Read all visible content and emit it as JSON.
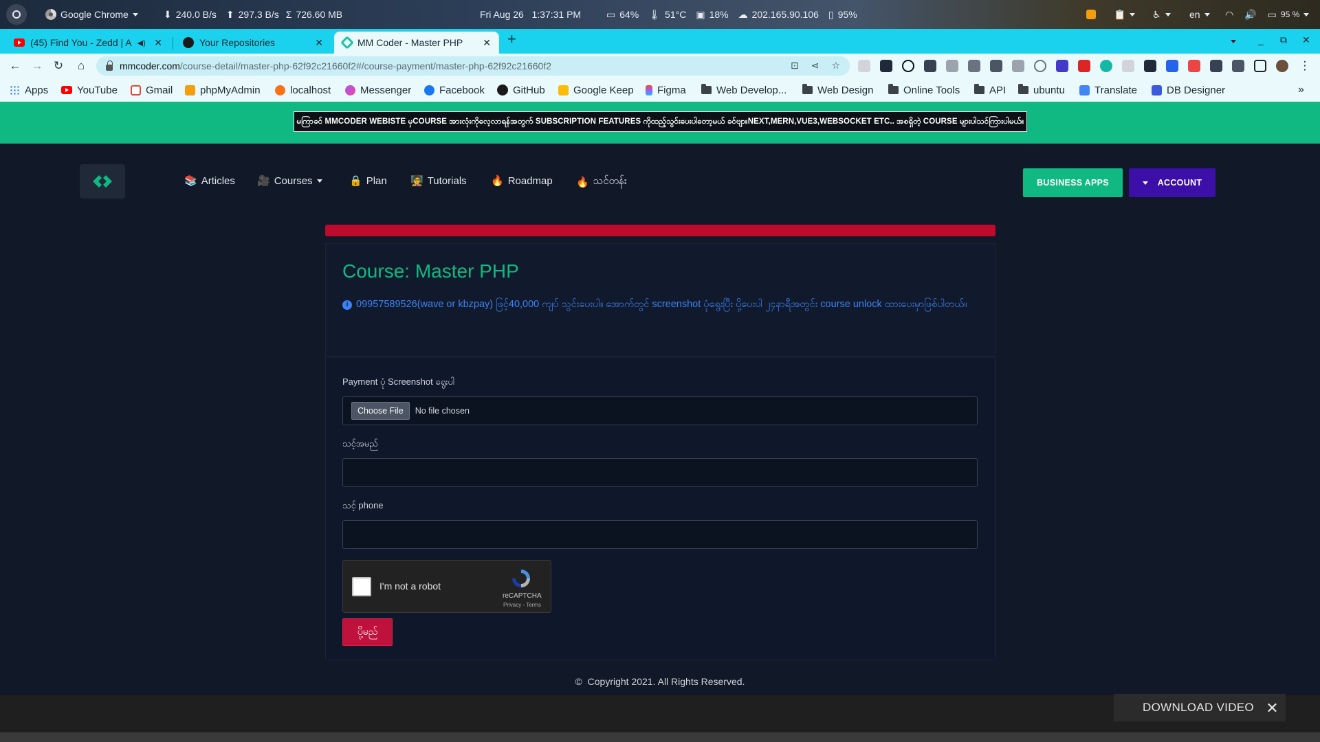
{
  "os_panel": {
    "app_name": "Google Chrome",
    "download_speed": "240.0 B/s",
    "upload_speed": "297.3 B/s",
    "total_transfer": "726.60 MB",
    "datetime": "Fri Aug 26   1:37:31 PM",
    "cpu": "64%",
    "temperature": "51°C",
    "memory": "18%",
    "ip": "202.165.90.106",
    "disk": "95%",
    "language": "en",
    "battery": "95 %"
  },
  "tabs": [
    {
      "title": "(45) Find You - Zedd | A",
      "favicon": "youtube-icon",
      "muted_icon": "speaker-icon"
    },
    {
      "title": "Your Repositories",
      "favicon": "github-icon"
    },
    {
      "title": "MM Coder - Master PHP",
      "favicon": "mmcoder-icon",
      "active": true
    }
  ],
  "address_bar": {
    "host": "mmcoder.com",
    "path": "/course-detail/master-php-62f92c21660f2#/course-payment/master-php-62f92c21660f2"
  },
  "bookmarks": [
    {
      "label": "Apps",
      "icon": "apps-grid-icon"
    },
    {
      "label": "YouTube",
      "icon": "youtube-icon"
    },
    {
      "label": "Gmail",
      "icon": "gmail-icon"
    },
    {
      "label": "phpMyAdmin",
      "icon": "phpmyadmin-icon"
    },
    {
      "label": "localhost",
      "icon": "localhost-icon"
    },
    {
      "label": "Messenger",
      "icon": "messenger-icon"
    },
    {
      "label": "Facebook",
      "icon": "facebook-icon"
    },
    {
      "label": "GitHub",
      "icon": "github-icon"
    },
    {
      "label": "Google Keep",
      "icon": "keep-icon"
    },
    {
      "label": "Figma",
      "icon": "figma-icon"
    },
    {
      "label": "Web Develop...",
      "icon": "folder-icon"
    },
    {
      "label": "Web Design",
      "icon": "folder-icon"
    },
    {
      "label": "Online Tools",
      "icon": "folder-icon"
    },
    {
      "label": "API",
      "icon": "folder-icon"
    },
    {
      "label": "ubuntu",
      "icon": "folder-icon"
    },
    {
      "label": "Translate",
      "icon": "translate-icon"
    },
    {
      "label": "DB Designer",
      "icon": "dbdesigner-icon"
    }
  ],
  "notice": "မကြာခင် MMCODER WEBISTE မှCOURSE အားလုံးကိုလေ့လာရန်အတွက် SUBSCRIPTION FEATURES ကိုထည့်သွင်းပေးပါတော့မယ် ခင်ဗျာ။NEXT,MERN,VUE3,WEBSOCKET ETC.. အစရှိတဲ့ COURSE များပါသင်ကြားပါမယ်။",
  "nav": {
    "links": [
      {
        "label": "Articles",
        "emoji": "📚"
      },
      {
        "label": "Courses",
        "emoji": "🎥"
      },
      {
        "label": "Plan",
        "emoji": "🔒"
      },
      {
        "label": "Tutorials",
        "emoji": "🧑‍🏫"
      },
      {
        "label": "Roadmap",
        "emoji": "🔥"
      },
      {
        "label": "သင်တန်း",
        "emoji": "🔥"
      }
    ],
    "business_apps": "BUSINESS APPS",
    "account": "ACCOUNT"
  },
  "course": {
    "title": "Course: Master PHP",
    "info": "09957589526(wave or kbzpay) ဖြင့်40,000 ကျပ် သွင်းပေးပါ။ အောက်တွင် screenshot ပုံရွေးပြီး ပို့ပေးပါ ၂၄နာရီအတွင်း course unlock ထားပေးမှာဖြစ်ပါတယ်။"
  },
  "form": {
    "screenshot_label": "Payment ပုံ Screenshot ရွေးပါ",
    "choose_file": "Choose File",
    "no_file": "No file chosen",
    "name_label": "သင့်အမည်",
    "phone_label": "သင့် phone",
    "captcha_text": "I'm not a robot",
    "captcha_brand": "reCAPTCHA",
    "captcha_links": "Privacy - Terms",
    "submit": "ပို့မည်"
  },
  "footer": {
    "copyright": "©  Copyright 2021. All Rights Reserved."
  },
  "download_video": "DOWNLOAD VIDEO",
  "colors": {
    "accent_green": "#10b981",
    "account_purple": "#3b0fa8",
    "progress_red": "#be0a2c",
    "info_blue": "#3b82f6",
    "tab_strip": "#1bd2ee"
  }
}
